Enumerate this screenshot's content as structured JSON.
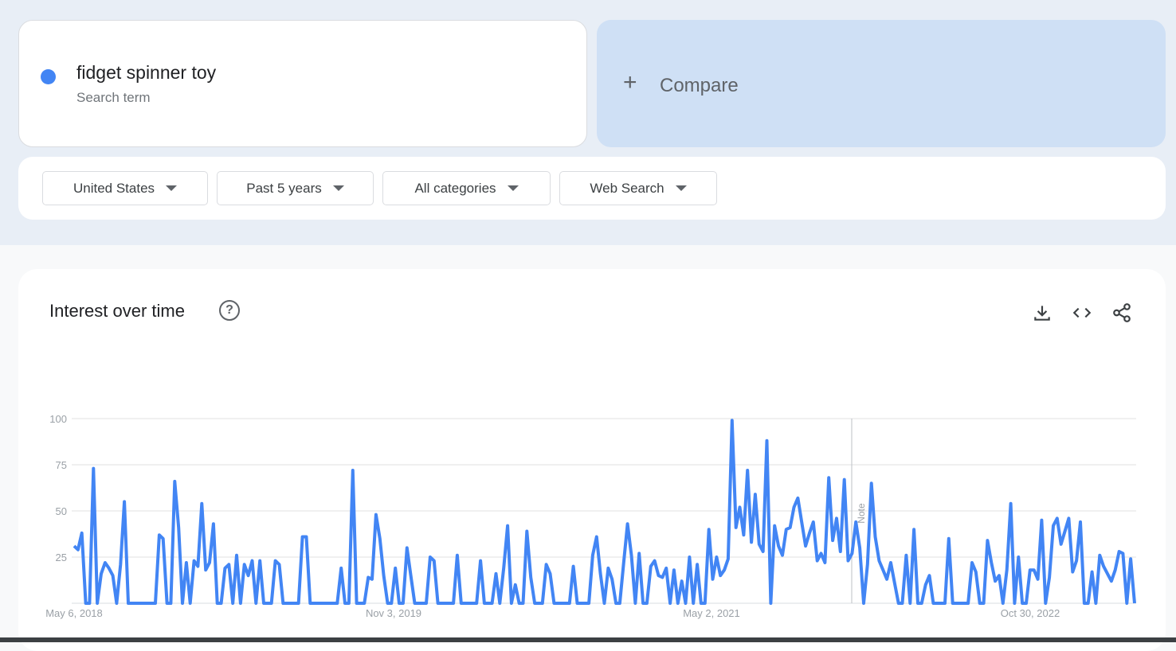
{
  "term": {
    "name": "fidget spinner toy",
    "subtitle": "Search term",
    "color": "#4285f4"
  },
  "compare": {
    "label": "Compare",
    "icon": "plus-icon"
  },
  "filters": [
    {
      "label": "United States"
    },
    {
      "label": "Past 5 years"
    },
    {
      "label": "All categories"
    },
    {
      "label": "Web Search"
    }
  ],
  "chart_section": {
    "title": "Interest over time",
    "help_icon": "help-circle-icon",
    "tools": [
      "download-icon",
      "embed-code-icon",
      "share-icon"
    ],
    "note_label": "Note"
  },
  "chart_data": {
    "type": "line",
    "ylim": [
      0,
      100
    ],
    "y_ticks": [
      "100",
      "75",
      "50",
      "25"
    ],
    "x_tick_labels": [
      "May 6, 2018",
      "Nov 3, 2019",
      "May 2, 2021",
      "Oct 30, 2022"
    ],
    "grid": true,
    "series": [
      {
        "name": "fidget spinner toy",
        "color": "#4285f4",
        "values": [
          31,
          29,
          38,
          0,
          0,
          73,
          0,
          16,
          22,
          19,
          15,
          0,
          21,
          55,
          0,
          0,
          0,
          0,
          0,
          0,
          0,
          0,
          37,
          35,
          0,
          0,
          66,
          41,
          0,
          22,
          0,
          23,
          20,
          54,
          18,
          22,
          43,
          0,
          0,
          19,
          21,
          0,
          26,
          0,
          21,
          15,
          23,
          0,
          23,
          0,
          0,
          0,
          23,
          21,
          0,
          0,
          0,
          0,
          0,
          36,
          36,
          0,
          0,
          0,
          0,
          0,
          0,
          0,
          0,
          19,
          0,
          0,
          72,
          0,
          0,
          0,
          14,
          13,
          48,
          35,
          15,
          0,
          0,
          19,
          0,
          0,
          30,
          15,
          0,
          0,
          0,
          0,
          25,
          23,
          0,
          0,
          0,
          0,
          0,
          26,
          0,
          0,
          0,
          0,
          0,
          23,
          0,
          0,
          0,
          16,
          0,
          19,
          42,
          0,
          10,
          0,
          0,
          39,
          14,
          0,
          0,
          0,
          21,
          16,
          0,
          0,
          0,
          0,
          0,
          20,
          0,
          0,
          0,
          0,
          26,
          36,
          16,
          0,
          19,
          13,
          0,
          0,
          22,
          43,
          26,
          0,
          27,
          0,
          0,
          20,
          23,
          15,
          14,
          19,
          0,
          18,
          0,
          12,
          0,
          25,
          0,
          21,
          0,
          0,
          40,
          13,
          25,
          15,
          18,
          24,
          99,
          41,
          52,
          37,
          72,
          33,
          59,
          32,
          28,
          88,
          0,
          42,
          31,
          26,
          40,
          41,
          52,
          57,
          44,
          31,
          38,
          44,
          23,
          27,
          22,
          68,
          34,
          46,
          28,
          67,
          23,
          27,
          44,
          30,
          0,
          21,
          65,
          36,
          23,
          18,
          13,
          22,
          11,
          0,
          0,
          26,
          0,
          40,
          0,
          0,
          10,
          15,
          0,
          0,
          0,
          0,
          35,
          0,
          0,
          0,
          0,
          0,
          22,
          17,
          0,
          0,
          34,
          22,
          12,
          15,
          0,
          18,
          54,
          0,
          25,
          0,
          0,
          18,
          18,
          13,
          45,
          0,
          14,
          42,
          46,
          32,
          39,
          46,
          17,
          23,
          44,
          0,
          0,
          17,
          0,
          26,
          20,
          16,
          12,
          18,
          28,
          27,
          0,
          24,
          0
        ]
      }
    ]
  }
}
